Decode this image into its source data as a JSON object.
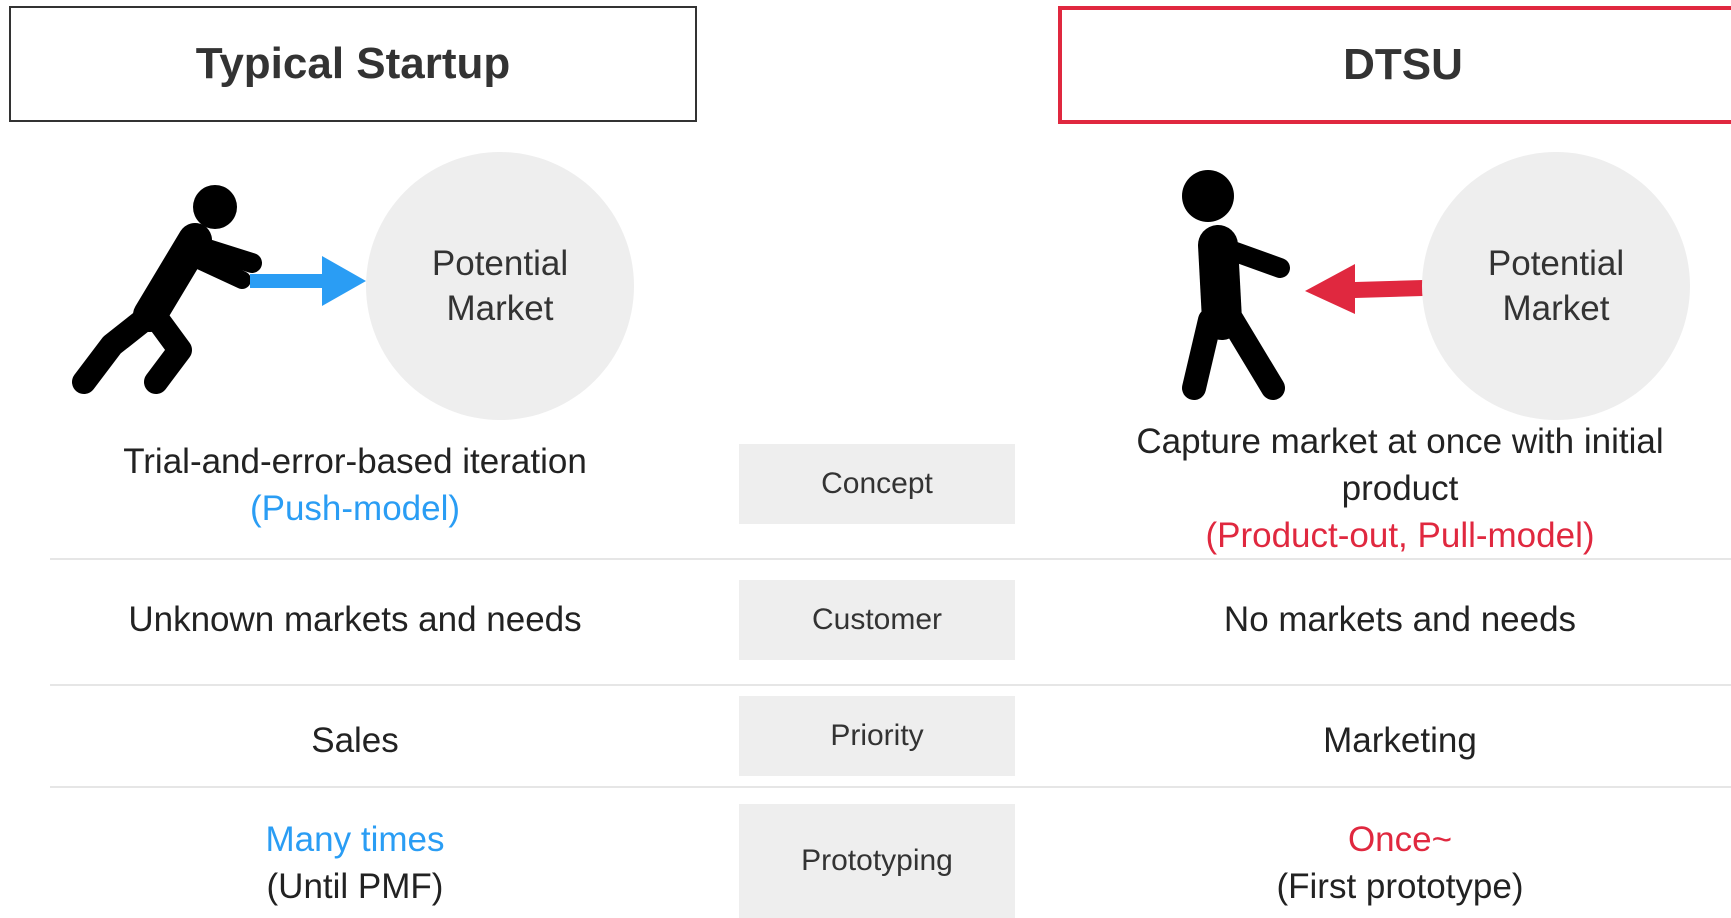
{
  "left_header": {
    "label": "Typical Startup"
  },
  "right_header": {
    "label": "DTSU"
  },
  "colors": {
    "accent_blue": "#2a9df4",
    "accent_red": "#e0283f",
    "header_border_left": "#333333",
    "circle_fill": "#eeeeee"
  },
  "icons": {
    "left_figure": "person-pushing-icon",
    "right_figure": "person-pulling-icon",
    "left_arrow": "arrow-right-icon",
    "right_arrow": "arrow-left-icon"
  },
  "left_circle": {
    "line1": "Potential",
    "line2": "Market"
  },
  "right_circle": {
    "line1": "Potential",
    "line2": "Market"
  },
  "rows": [
    {
      "category": "Concept",
      "left": {
        "line1": "Trial-and-error-based iteration",
        "line2": "(Push-model)"
      },
      "right": {
        "line1": "Capture market at once with initial",
        "line2": "product",
        "line3": "(Product-out, Pull-model)"
      }
    },
    {
      "category": "Customer",
      "left": {
        "line1": "Unknown markets and needs"
      },
      "right": {
        "line1": "No markets and needs"
      }
    },
    {
      "category": "Priority",
      "left": {
        "line1": "Sales"
      },
      "right": {
        "line1": "Marketing"
      }
    },
    {
      "category": "Prototyping",
      "left": {
        "line1": "Many times",
        "line2": "(Until PMF)"
      },
      "right": {
        "line1": "Once~",
        "line2": "(First prototype)"
      }
    }
  ]
}
